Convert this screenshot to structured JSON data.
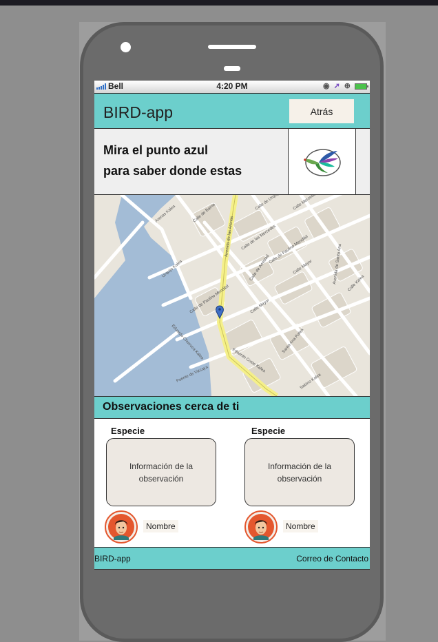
{
  "status_bar": {
    "carrier": "Bell",
    "time": "4:20 PM"
  },
  "header": {
    "title": "BIRD-app",
    "back_label": "Atrás"
  },
  "banner": {
    "line1": "Mira el punto azul",
    "line2": "para saber donde estas"
  },
  "map": {
    "street_labels": [
      "Calle de Barria",
      "Calle de Urquijo",
      "Avenida de las Arenas",
      "Calle de las Mercedes",
      "Calle Mercedes",
      "Calle de Paulino Mendibil",
      "Calle de Amistad",
      "Calle Mayor",
      "Calle Mayor",
      "Avenida de Santa Ana",
      "Calle Kalea",
      "Arenas Kalea",
      "Urquijo Kalea",
      "Eduardo Coste Kalea",
      "Eduardo Churruca Kalea",
      "Santa Ana Kalea",
      "Sabino Kalea",
      "Puente de Vizcaya",
      "Calle de Paulino Mendibil"
    ],
    "location_marker": "blue-pin"
  },
  "observations": {
    "title": "Observaciones cerca de ti",
    "items": [
      {
        "species": "Especie",
        "info": "Información de la observación",
        "user": "Nombre"
      },
      {
        "species": "Especie",
        "info": "Información de la observación",
        "user": "Nombre"
      }
    ]
  },
  "footer": {
    "left": "BIRD-app",
    "right": "Correo de Contacto"
  },
  "colors": {
    "accent": "#6ccfcc",
    "map_water": "#a3bcd6",
    "map_land": "#e9e5dc",
    "main_road": "#f5f08a"
  },
  "icons": [
    "signal-icon",
    "location-arrow-icon",
    "battery-icon",
    "bird-logo-icon",
    "location-pin-icon",
    "avatar-icon"
  ]
}
